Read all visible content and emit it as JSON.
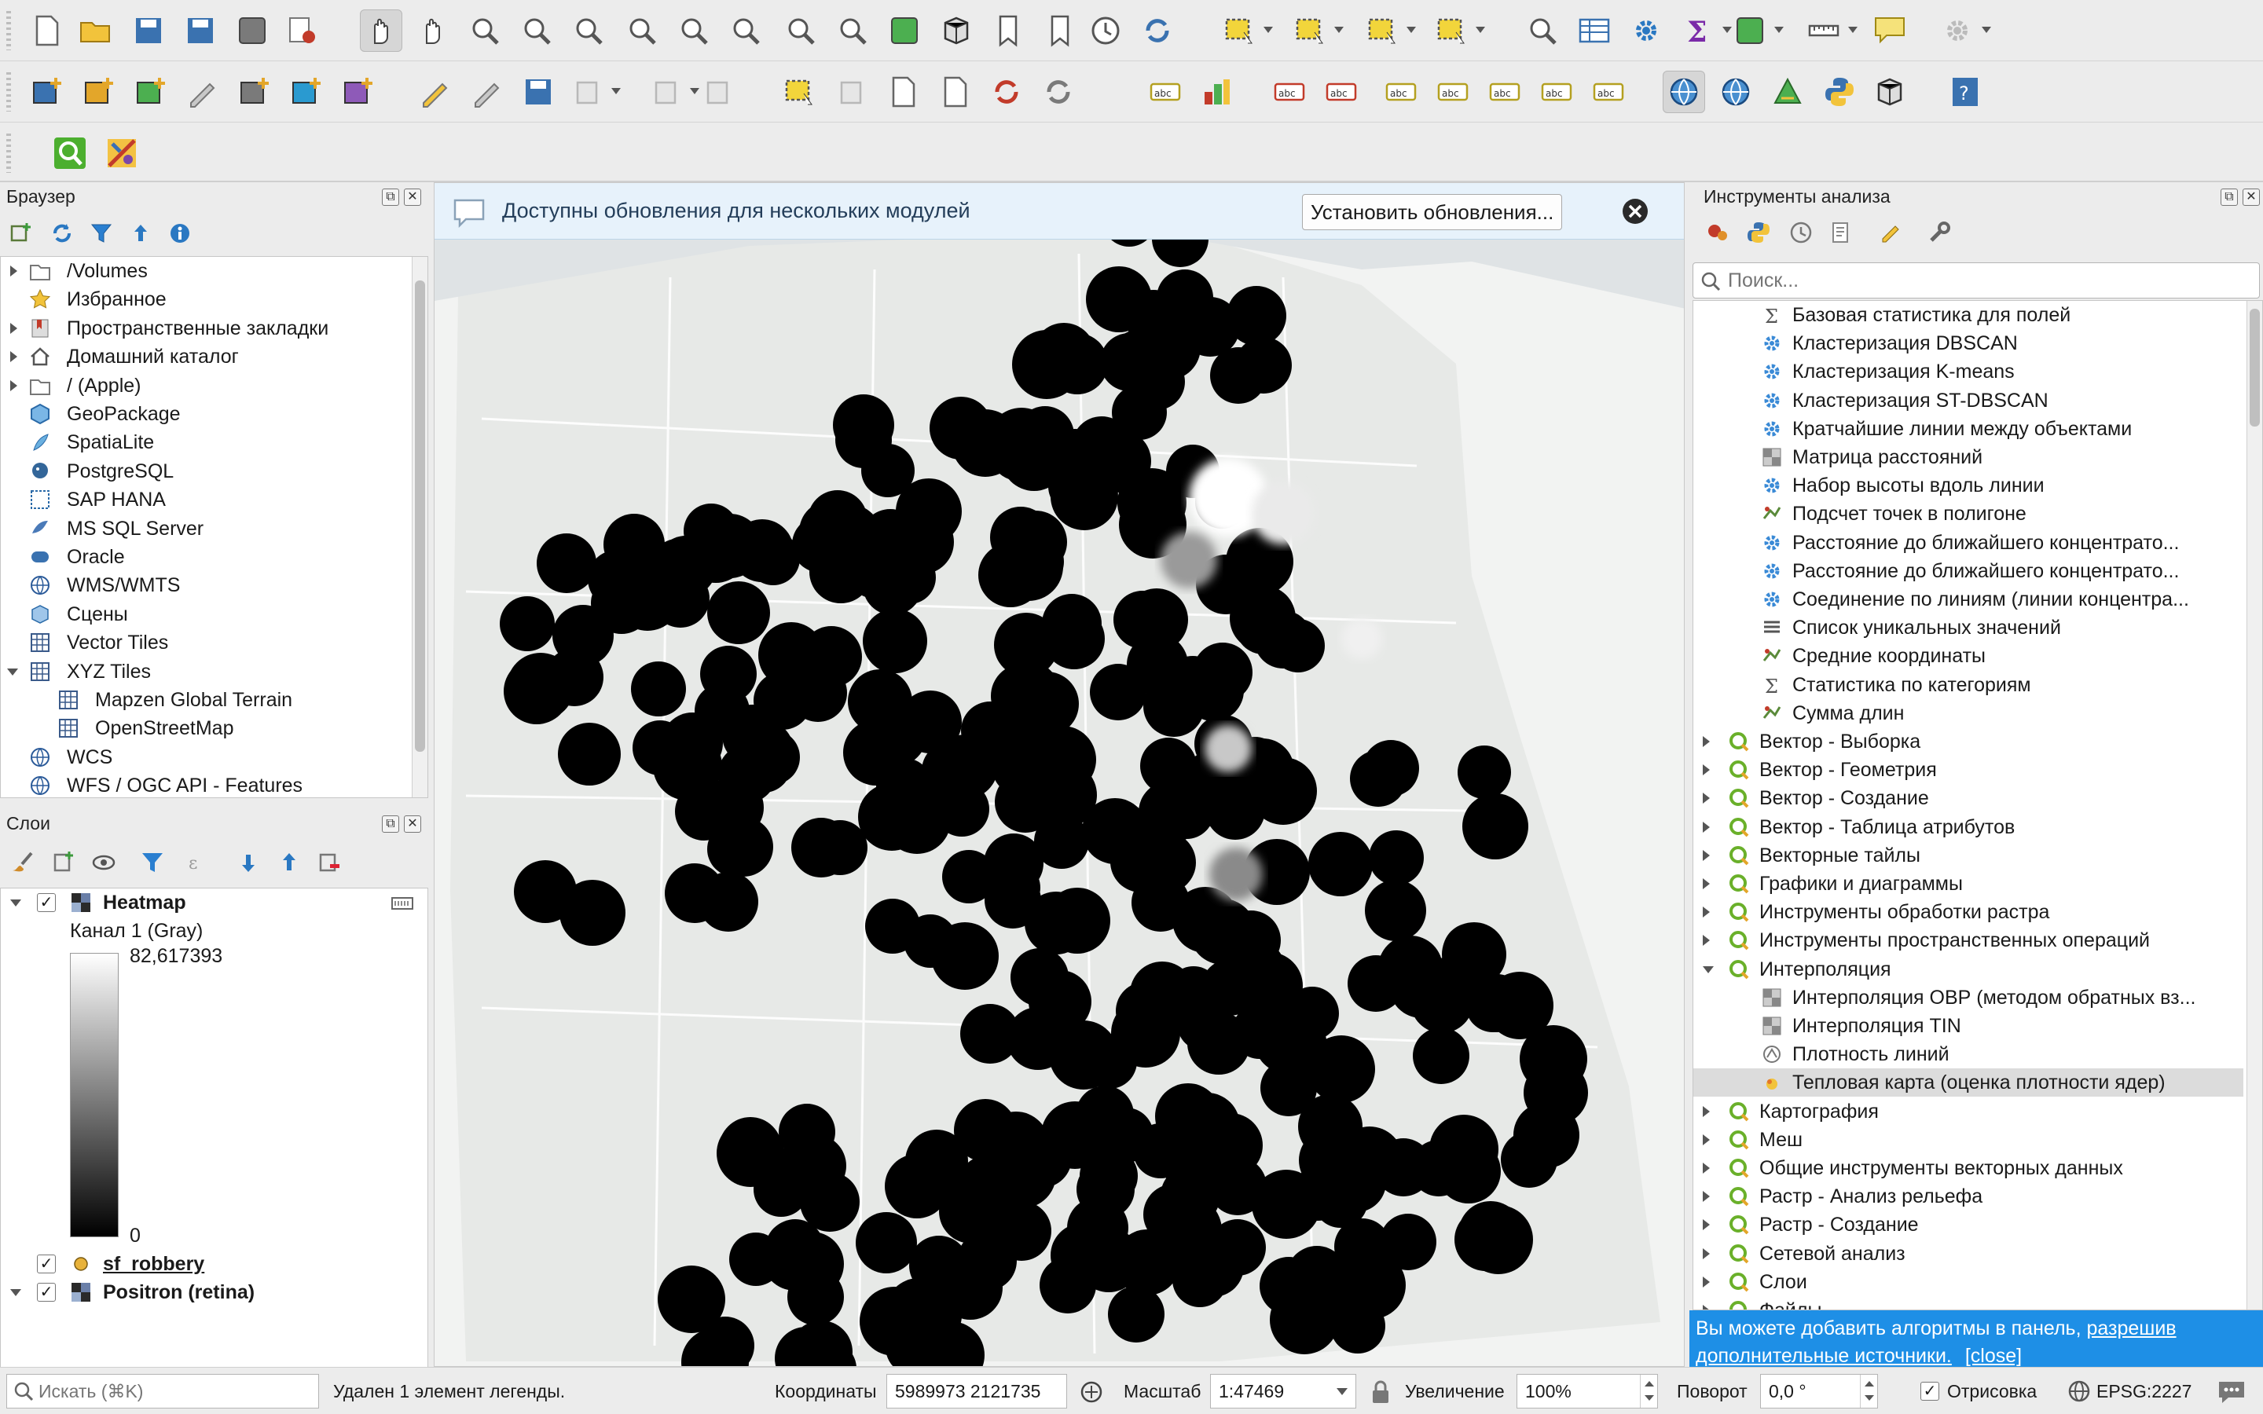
{
  "browser": {
    "title": "Браузер",
    "items": [
      {
        "label": "/Volumes",
        "expand": "r",
        "icon": "folder-icon",
        "indent": 0
      },
      {
        "label": "Избранное",
        "expand": "",
        "icon": "star-icon",
        "indent": 0
      },
      {
        "label": "Пространственные закладки",
        "expand": "r",
        "icon": "bookmark-icon",
        "indent": 0
      },
      {
        "label": "Домашний каталог",
        "expand": "r",
        "icon": "home-icon",
        "indent": 0
      },
      {
        "label": "/ (Apple)",
        "expand": "r",
        "icon": "folder-icon",
        "indent": 0
      },
      {
        "label": "GeoPackage",
        "expand": "",
        "icon": "geopackage-icon",
        "indent": 0
      },
      {
        "label": "SpatiaLite",
        "expand": "",
        "icon": "spatialite-icon",
        "indent": 0
      },
      {
        "label": "PostgreSQL",
        "expand": "",
        "icon": "postgresql-icon",
        "indent": 0
      },
      {
        "label": "SAP HANA",
        "expand": "",
        "icon": "sap-hana-icon",
        "indent": 0
      },
      {
        "label": "MS SQL Server",
        "expand": "",
        "icon": "mssql-icon",
        "indent": 0
      },
      {
        "label": "Oracle",
        "expand": "",
        "icon": "oracle-icon",
        "indent": 0
      },
      {
        "label": "WMS/WMTS",
        "expand": "",
        "icon": "wms-icon",
        "indent": 0
      },
      {
        "label": "Сцены",
        "expand": "",
        "icon": "scenes-icon",
        "indent": 0
      },
      {
        "label": "Vector Tiles",
        "expand": "",
        "icon": "vector-tiles-icon",
        "indent": 0
      },
      {
        "label": "XYZ Tiles",
        "expand": "d",
        "icon": "xyz-tiles-icon",
        "indent": 0
      },
      {
        "label": "Mapzen Global Terrain",
        "expand": "",
        "icon": "xyz-tiles-icon",
        "indent": 1
      },
      {
        "label": "OpenStreetMap",
        "expand": "",
        "icon": "xyz-tiles-icon",
        "indent": 1
      },
      {
        "label": "WCS",
        "expand": "",
        "icon": "wcs-icon",
        "indent": 0
      },
      {
        "label": "WFS / OGC API - Features",
        "expand": "",
        "icon": "wfs-icon",
        "indent": 0
      }
    ]
  },
  "layers": {
    "title": "Слои",
    "heatmap": {
      "label": "Heatmap",
      "band": "Канал 1 (Gray)",
      "max": "82,617393",
      "min": "0"
    },
    "sf_robbery": {
      "label": "sf_robbery",
      "color": "#e8b23a"
    },
    "positron": {
      "label": "Positron (retina)"
    }
  },
  "messagebar": {
    "text": "Доступны обновления для нескольких модулей",
    "button": "Установить обновления..."
  },
  "processing": {
    "title": "Инструменты анализа",
    "search_placeholder": "Поиск...",
    "items": [
      {
        "label": "Базовая статистика для полей",
        "icon": "sigma-icon",
        "indent": 1
      },
      {
        "label": "Кластеризация DBSCAN",
        "icon": "gear-algo-icon",
        "indent": 1
      },
      {
        "label": "Кластеризация K-means",
        "icon": "gear-algo-icon",
        "indent": 1
      },
      {
        "label": "Кластеризация ST-DBSCAN",
        "icon": "gear-algo-icon",
        "indent": 1
      },
      {
        "label": "Кратчайшие линии между объектами",
        "icon": "gear-algo-icon",
        "indent": 1
      },
      {
        "label": "Матрица расстояний",
        "icon": "matrix-icon",
        "indent": 1
      },
      {
        "label": "Набор высоты вдоль линии",
        "icon": "gear-algo-icon",
        "indent": 1
      },
      {
        "label": "Подсчет точек в полигоне",
        "icon": "count-points-icon",
        "indent": 1
      },
      {
        "label": "Расстояние до ближайшего концентрато...",
        "icon": "gear-algo-icon",
        "indent": 1
      },
      {
        "label": "Расстояние до ближайшего концентрато...",
        "icon": "gear-algo-icon",
        "indent": 1
      },
      {
        "label": "Соединение по линиям (линии концентра...",
        "icon": "gear-algo-icon",
        "indent": 1
      },
      {
        "label": "Список уникальных значений",
        "icon": "list-icon",
        "indent": 1
      },
      {
        "label": "Средние координаты",
        "icon": "mean-coords-icon",
        "indent": 1
      },
      {
        "label": "Статистика по категориям",
        "icon": "sigma-icon",
        "indent": 1
      },
      {
        "label": "Сумма длин",
        "icon": "sum-lengths-icon",
        "indent": 1
      },
      {
        "label": "Вектор - Выборка",
        "icon": "qgis-q-icon",
        "indent": 0,
        "expand": "r"
      },
      {
        "label": "Вектор - Геометрия",
        "icon": "qgis-q-icon",
        "indent": 0,
        "expand": "r"
      },
      {
        "label": "Вектор - Создание",
        "icon": "qgis-q-icon",
        "indent": 0,
        "expand": "r"
      },
      {
        "label": "Вектор - Таблица атрибутов",
        "icon": "qgis-q-icon",
        "indent": 0,
        "expand": "r"
      },
      {
        "label": "Векторные тайлы",
        "icon": "qgis-q-icon",
        "indent": 0,
        "expand": "r"
      },
      {
        "label": "Графики и диаграммы",
        "icon": "qgis-q-icon",
        "indent": 0,
        "expand": "r"
      },
      {
        "label": "Инструменты обработки растра",
        "icon": "qgis-q-icon",
        "indent": 0,
        "expand": "r"
      },
      {
        "label": "Инструменты пространственных операций",
        "icon": "qgis-q-icon",
        "indent": 0,
        "expand": "r"
      },
      {
        "label": "Интерполяция",
        "icon": "qgis-q-icon",
        "indent": 0,
        "expand": "d"
      },
      {
        "label": "Интерполяция ОВР (методом обратных вз...",
        "icon": "idw-icon",
        "indent": 1
      },
      {
        "label": "Интерполяция TIN",
        "icon": "tin-icon",
        "indent": 1
      },
      {
        "label": "Плотность линий",
        "icon": "line-density-icon",
        "indent": 1
      },
      {
        "label": "Тепловая карта (оценка плотности ядер)",
        "icon": "heatmap-icon",
        "indent": 1,
        "selected": true
      },
      {
        "label": "Картография",
        "icon": "qgis-q-icon",
        "indent": 0,
        "expand": "r"
      },
      {
        "label": "Меш",
        "icon": "qgis-q-icon",
        "indent": 0,
        "expand": "r"
      },
      {
        "label": "Общие инструменты векторных данных",
        "icon": "qgis-q-icon",
        "indent": 0,
        "expand": "r"
      },
      {
        "label": "Растр - Анализ рельефа",
        "icon": "qgis-q-icon",
        "indent": 0,
        "expand": "r"
      },
      {
        "label": "Растр - Создание",
        "icon": "qgis-q-icon",
        "indent": 0,
        "expand": "r"
      },
      {
        "label": "Сетевой анализ",
        "icon": "qgis-q-icon",
        "indent": 0,
        "expand": "r"
      },
      {
        "label": "Слои",
        "icon": "qgis-q-icon",
        "indent": 0,
        "expand": "r"
      },
      {
        "label": "Файлы",
        "icon": "qgis-q-icon",
        "indent": 0,
        "expand": "r"
      }
    ],
    "info_text": "Вы можете добавить алгоритмы в панель,",
    "info_link": "разрешив дополнительные источники.",
    "info_close": "[close]"
  },
  "status": {
    "search_placeholder": "Искать (⌘K)",
    "message": "Удален 1 элемент легенды.",
    "coords_label": "Координаты",
    "coords_value": "5989973  2121735",
    "scale_label": "Масштаб",
    "scale_value": "1:47469",
    "zoom_label": "Увеличение",
    "zoom_value": "100%",
    "rotation_label": "Поворот",
    "rotation_value": "0,0 °",
    "render_label": "Отрисовка",
    "crs": "EPSG:2227"
  },
  "icons_tb1": [
    "new-project-icon",
    "open-project-icon",
    "save-project-icon",
    "save-as-icon",
    "project-properties-icon",
    "style-manager-icon",
    "pan-icon",
    "pan-to-selection-icon",
    "zoom-in-icon",
    "zoom-out-icon",
    "zoom-full-icon",
    "zoom-selection-icon",
    "zoom-layer-icon",
    "zoom-native-icon",
    "zoom-last-icon",
    "zoom-next-icon",
    "new-map-view-icon",
    "new-3d-view-icon",
    "new-bookmark-icon",
    "show-bookmarks-icon",
    "temporal-controller-icon",
    "refresh-icon",
    "select-features-icon",
    "select-value-icon",
    "deselect-icon",
    "select-location-icon",
    "identify-icon",
    "attribute-table-icon",
    "processing-toolbox-icon",
    "statistics-icon",
    "field-calculator-icon",
    "measure-icon",
    "annotation-icon",
    "settings-icon"
  ],
  "icons_tb2": [
    "add-vector-icon",
    "add-raster-icon",
    "add-delimited-icon",
    "digitize-icon",
    "add-gps-icon",
    "add-mesh-icon",
    "add-vector-tile-icon",
    "edit-pencil-icon",
    "toggle-edit-icon",
    "save-edits-icon",
    "add-feature-icon",
    "vertex-tool-icon",
    "modify-attributes-icon",
    "delete-selected-icon",
    "cut-icon",
    "copy-icon",
    "paste-icon",
    "undo-icon",
    "redo-icon",
    "label-abc-icon",
    "diagram-icon",
    "highlight-label-icon",
    "pin-label-icon",
    "show-label-icon",
    "move-label-icon",
    "rotate-label-icon",
    "change-label-icon",
    "label-toolbar-icon",
    "globe-add-icon",
    "globe-icon",
    "terrain-icon",
    "python-console-icon",
    "3d-icon",
    "help-icon"
  ]
}
